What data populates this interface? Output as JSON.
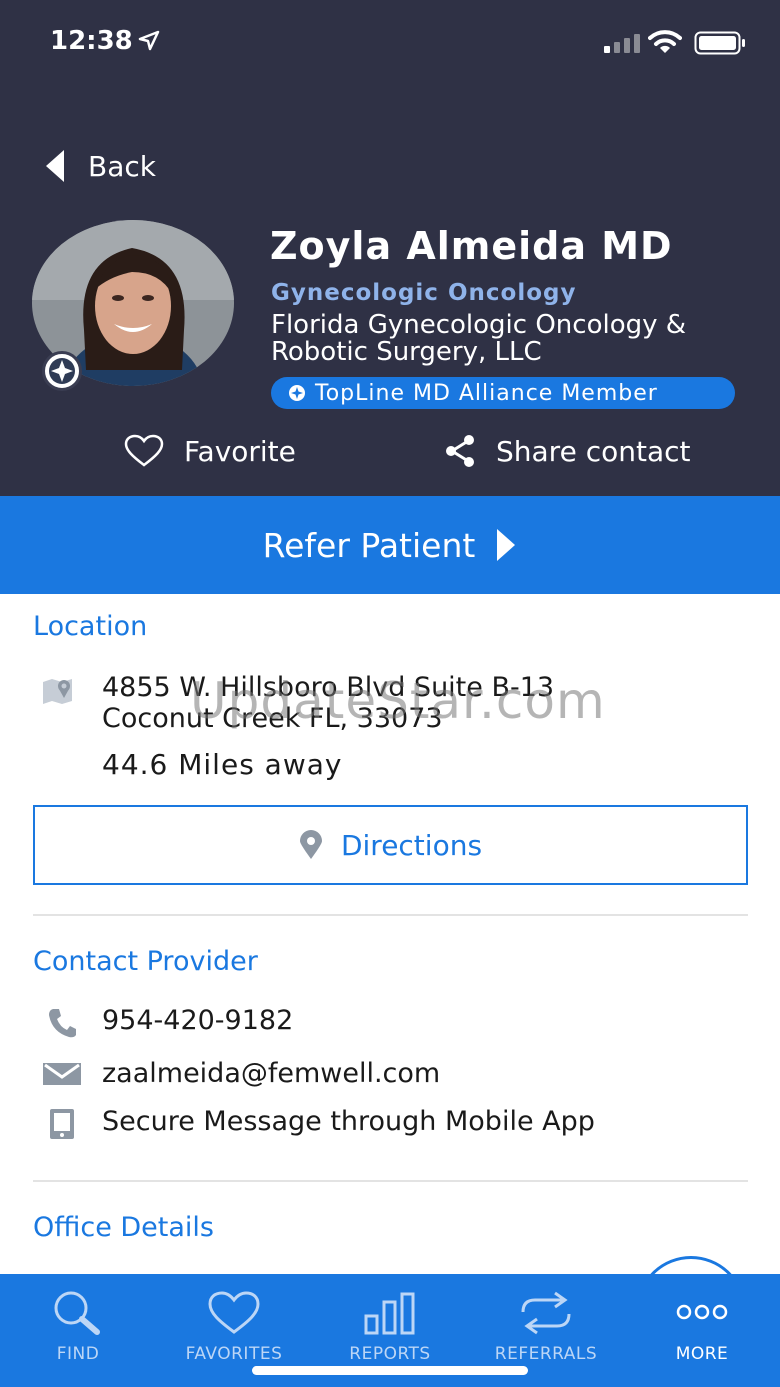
{
  "status_bar": {
    "time": "12:38"
  },
  "header": {
    "back_label": "Back",
    "name": "Zoyla Almeida MD",
    "specialty": "Gynecologic Oncology",
    "practice": "Florida Gynecologic Oncology & Robotic Surgery, LLC",
    "badge": "TopLine MD Alliance Member",
    "favorite_label": "Favorite",
    "share_label": "Share contact"
  },
  "refer": {
    "label": "Refer Patient"
  },
  "location": {
    "title": "Location",
    "address_line1": "4855 W. Hillsboro Blvd Suite B-13",
    "address_line2": "Coconut Creek FL, 33073",
    "distance": "44.6 Miles away",
    "directions_label": "Directions"
  },
  "contact": {
    "title": "Contact Provider",
    "phone": "954-420-9182",
    "email": "zaalmeida@femwell.com",
    "secure_message": "Secure Message through Mobile App"
  },
  "office": {
    "title": "Office Details"
  },
  "watermark": "UpdateStar.com",
  "tabs": [
    {
      "label": "FIND",
      "icon": "search-icon"
    },
    {
      "label": "FAVORITES",
      "icon": "heart-icon"
    },
    {
      "label": "REPORTS",
      "icon": "bar-chart-icon"
    },
    {
      "label": "REFERRALS",
      "icon": "referral-arrows-icon"
    },
    {
      "label": "MORE",
      "icon": "more-dots-icon"
    }
  ],
  "colors": {
    "header_bg": "#2f3145",
    "accent": "#1a78e0",
    "specialty": "#8fb3ea"
  }
}
